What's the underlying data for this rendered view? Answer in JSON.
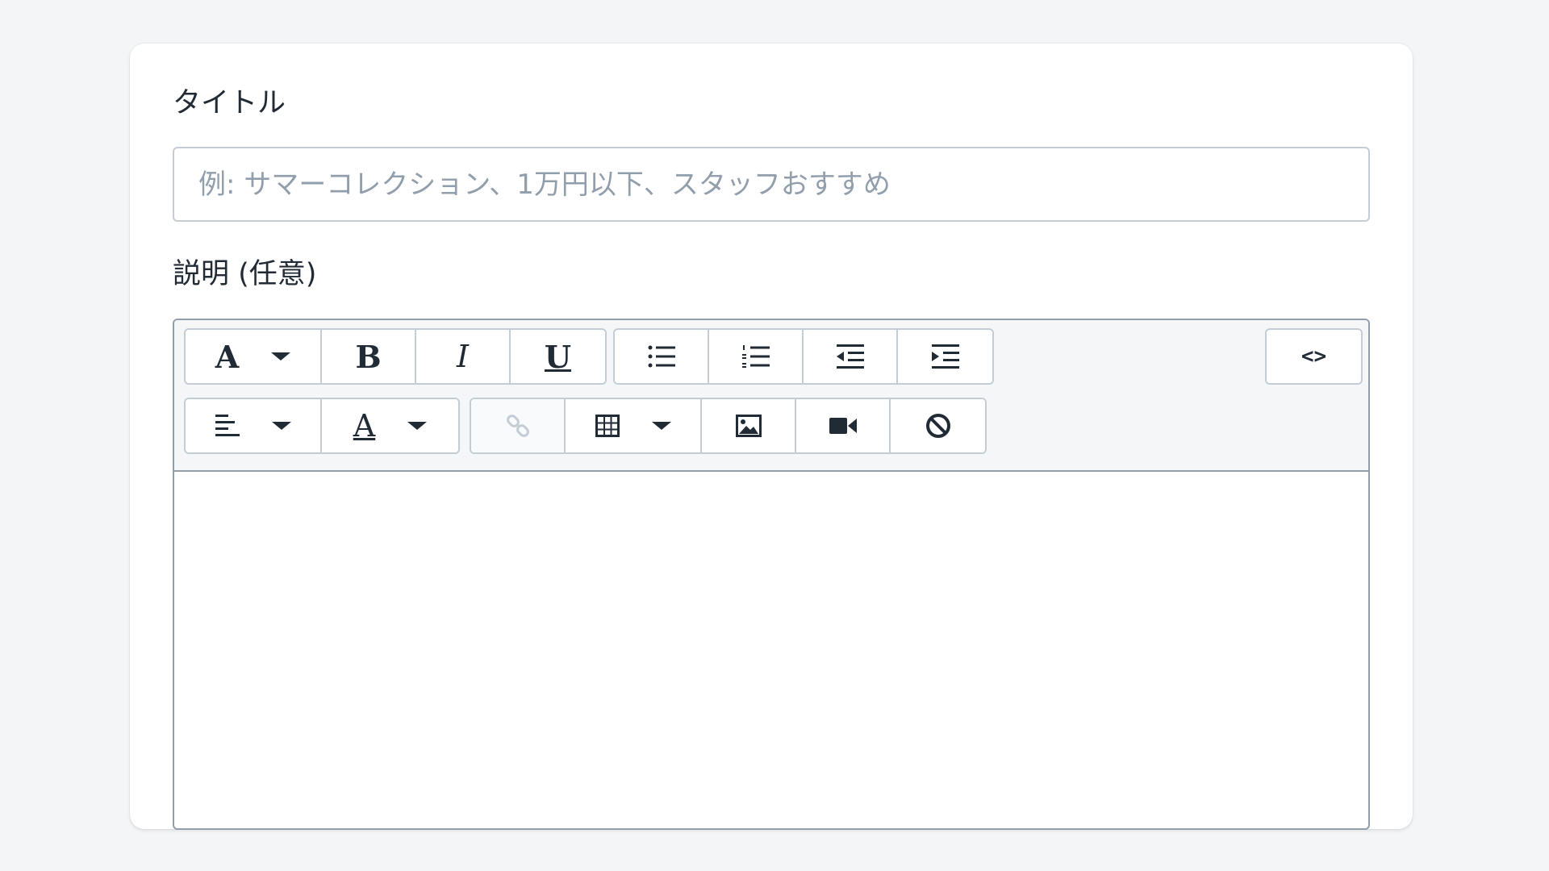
{
  "form": {
    "title_label": "タイトル",
    "title_placeholder": "例: サマーコレクション、1万円以下、スタッフおすすめ",
    "title_value": "",
    "description_label": "説明 (任意)",
    "description_value": ""
  },
  "toolbar": {
    "font_button": "A",
    "bold_button": "B",
    "italic_button": "I",
    "underline_button": "U",
    "text_color_button": "A",
    "html_toggle_button": "<>"
  },
  "colors": {
    "background": "#f4f5f7",
    "card": "#ffffff",
    "border": "#c4cdd5",
    "editor_border": "#919eab",
    "placeholder": "#919eab",
    "text": "#212b36"
  }
}
